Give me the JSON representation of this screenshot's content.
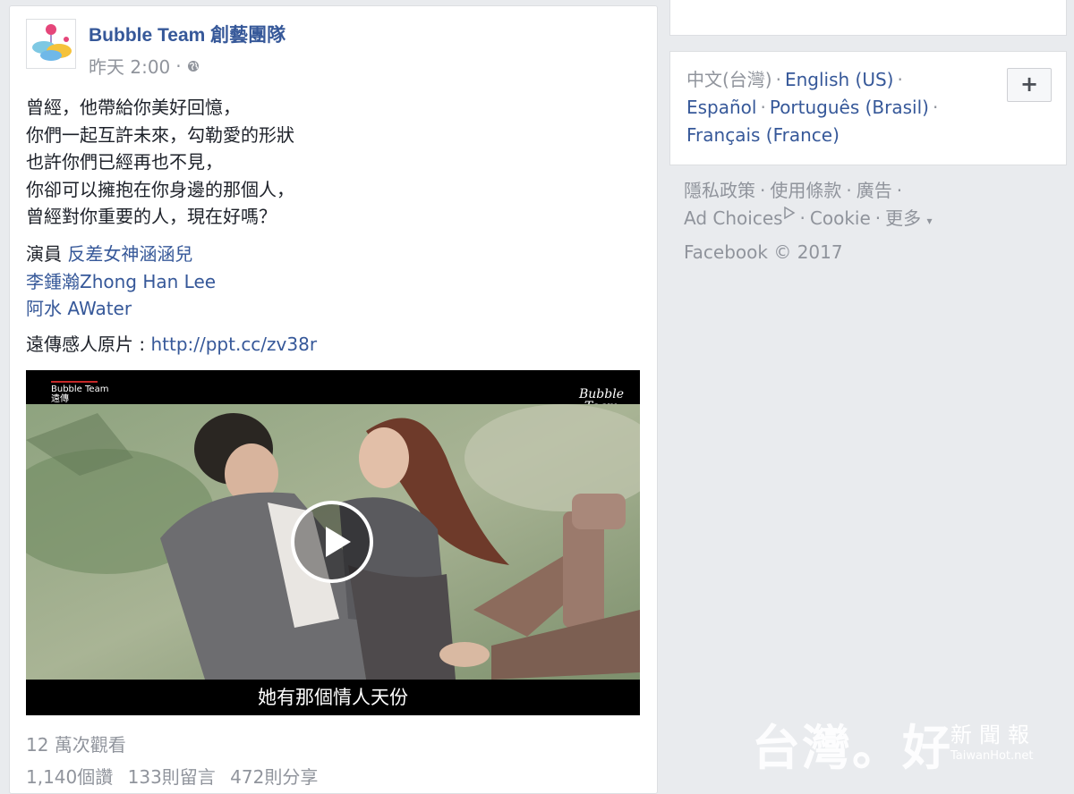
{
  "post": {
    "page_name": "Bubble Team 創藝團隊",
    "time": "昨天 2:00",
    "dot": "·",
    "text_lines": [
      "曾經，他帶給你美好回憶，",
      "你們一起互許未來，勾勒愛的形狀",
      "也許你們已經再也不見，",
      "你卻可以擁抱在你身邊的那個人，",
      "曾經對你重要的人，現在好嗎？"
    ],
    "cast_label": "演員",
    "cast": [
      "反差女神涵涵兒",
      "李鍾瀚Zhong Han Lee",
      "阿水 AWater"
    ],
    "original_label": "遠傳感人原片 : ",
    "original_link": "http://ppt.cc/zv38r",
    "video": {
      "brand_left": "Bubble Team",
      "brand_left_sub": "遠傳",
      "brand_right_1": "Bubble",
      "brand_right_2": "Team",
      "subtitle": "她有那個情人天份"
    },
    "views": "12 萬次觀看",
    "likes": "1,140個讚",
    "comments": "133則留言",
    "shares": "472則分享"
  },
  "sidebar": {
    "languages": [
      "中文(台灣)",
      "English (US)",
      "Español",
      "Português (Brasil)",
      "Français (France)"
    ],
    "plus_label": "+",
    "footer_links": [
      "隱私政策",
      "使用條款",
      "廣告",
      "Ad Choices",
      "Cookie",
      "更多"
    ],
    "more_caret": "▾",
    "copyright": "Facebook © 2017"
  },
  "watermark": {
    "big": "台灣。好",
    "small": "新聞報",
    "url": "TaiwanHot.net"
  }
}
